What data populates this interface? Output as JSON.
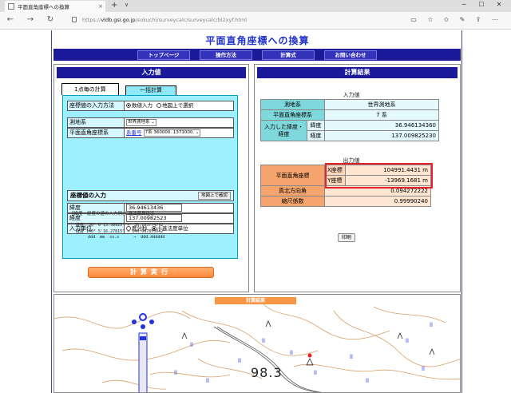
{
  "browser": {
    "tab_title": "平面直角座標への換算",
    "tab_close": "×",
    "new_tab": "+",
    "tab_dropdown": "∨",
    "window_controls": [
      "─",
      "☐",
      "✕"
    ],
    "url_host": "vldb.gsi.go.jp",
    "url_prefix": "https://",
    "url_path": "/sokuchi/surveycalc/surveycalc/bl2xyf.html",
    "back": "←",
    "forward": "→",
    "reload": "↻"
  },
  "page": {
    "title": "平面直角座標への換算",
    "menu": [
      "トップページ",
      "操作方法",
      "計算式",
      "お問い合わせ"
    ]
  },
  "input_panel": {
    "header": "入力値",
    "tabs": [
      "1点毎の計算",
      "一括計算"
    ],
    "method_label": "座標値の入力方法",
    "method_options": [
      "数値入力",
      "地図上で選択"
    ],
    "datum_label": "測地系",
    "datum_value": "世界測地系",
    "zone_label": "平面直角座標系",
    "zone_link": "系番号",
    "zone_value": "7系 360000. 1371000.",
    "coord_section": "座標値の入力",
    "map_confirm_button": "地図上で確認",
    "lat_label": "緯度",
    "lat_value": "36.94613436",
    "lon_label": "経度",
    "lon_value": "137.00982523",
    "unit_label": "入力単位",
    "unit_options": [
      "度分秒",
      "十進法度単位"
    ],
    "example_title": "【緯度・経度の値の入力例(十進法度単位)】",
    "example_lines": [
      "緯度  36° 6'13.58925\" →  36.103774792",
      "経度 140° 5'16.27815\" → 140.087855042",
      "     ddd  mm  ss.s      →  ddd.dddddd"
    ],
    "calc_button": "計算実行"
  },
  "result_panel": {
    "header": "計算結果",
    "input_caption": "入力値",
    "datum_label": "測地系",
    "datum_value": "世界測地系",
    "zone_label": "平面直角座標系",
    "zone_value": "7 系",
    "entered_label": "入力した緯度・経度",
    "lat_label": "緯度",
    "lat_value": "36.946134360",
    "lon_label": "経度",
    "lon_value": "137.009825230",
    "output_caption": "出力値",
    "xy_label": "平面直角座標",
    "x_label": "X座標",
    "x_value": "104991.4431 m",
    "y_label": "Y座標",
    "y_value": "-13969.1681 m",
    "meridian_label": "真北方向角",
    "meridian_value": "0.094272222",
    "scale_label": "縮尺係数",
    "scale_value": "0.99990240",
    "print_button": "印刷"
  },
  "map": {
    "tab_label": "計算結果",
    "elevation_label": "98.3",
    "accent": "#f79646",
    "contour_color": "#d9a06a",
    "symbol_color": "#2233dd"
  }
}
